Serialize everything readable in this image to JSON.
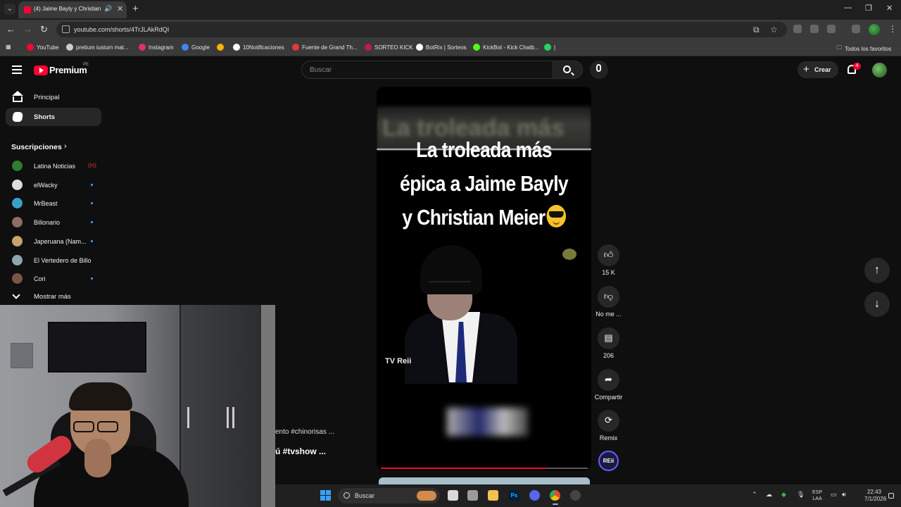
{
  "browser": {
    "tab_title": "(4) Jaime Bayly y Christian M",
    "url": "youtube.com/shorts/4TrJLAkRdQI",
    "bookmarks": [
      {
        "label": "YouTube",
        "color": "#ff0033"
      },
      {
        "label": "pretium iustum mat...",
        "color": "#cccccc"
      },
      {
        "label": "Instagram",
        "color": "#e1306c"
      },
      {
        "label": "Google",
        "color": "#4285f4"
      },
      {
        "label": "",
        "color": "#f4b400"
      },
      {
        "label": "10Notificaciones",
        "color": "#ffffff"
      },
      {
        "label": "Fuente de Grand Th...",
        "color": "#e53935"
      },
      {
        "label": "SORTEO KICK",
        "color": "#c2185b"
      },
      {
        "label": "BotRix | Sorteos",
        "color": "#ffffff"
      },
      {
        "label": "KickBot - Kick Chatb...",
        "color": "#53fc18"
      },
      {
        "label": "|",
        "color": "#25d366"
      }
    ],
    "all_bookmarks_label": "Todos los favoritos"
  },
  "youtube": {
    "logo_text": "Premium",
    "country_code": "PE",
    "search_placeholder": "Buscar",
    "create_label": "Crear",
    "notifications_count": "4"
  },
  "sidebar": {
    "items": [
      {
        "label": "Principal",
        "icon": "home-icon"
      },
      {
        "label": "Shorts",
        "icon": "shorts-icon"
      }
    ],
    "subscriptions_title": "Suscripciones",
    "subscriptions": [
      {
        "name": "Latina Noticias",
        "status": "live",
        "color": "#2e7d32"
      },
      {
        "name": "elWacky",
        "status": "new",
        "color": "#dddddd"
      },
      {
        "name": "MrBeast",
        "status": "new",
        "color": "#3aa0c8"
      },
      {
        "name": "Billonario",
        "status": "new",
        "color": "#8d6e63"
      },
      {
        "name": "Japeruana (Nam...",
        "status": "new",
        "color": "#c9a46a"
      },
      {
        "name": "El Vertedero de Billo",
        "status": "none",
        "color": "#90a4ae"
      },
      {
        "name": "Cori",
        "status": "new",
        "color": "#795548"
      }
    ],
    "show_more_label": "Mostrar más"
  },
  "short": {
    "title_lines": [
      "La troleada más",
      "épica a Jaime Bayly",
      "y Christian Meier"
    ],
    "blurred_header": "La troleada más",
    "watermark": "TV Reii",
    "progress": 0.8,
    "description_line1": "ento #chinorisas ...",
    "description_line2": "ú #tvshow ..."
  },
  "actions": {
    "like_count": "15 K",
    "dislike_label": "No me ...",
    "comments_count": "206",
    "share_label": "Compartir",
    "remix_label": "Remix",
    "channel_avatar_text": "REii"
  },
  "taskbar": {
    "search_label": "Buscar",
    "language_line1": "ESP",
    "language_line2": "LAA",
    "time": "22:43",
    "date": "7/1/2026"
  }
}
